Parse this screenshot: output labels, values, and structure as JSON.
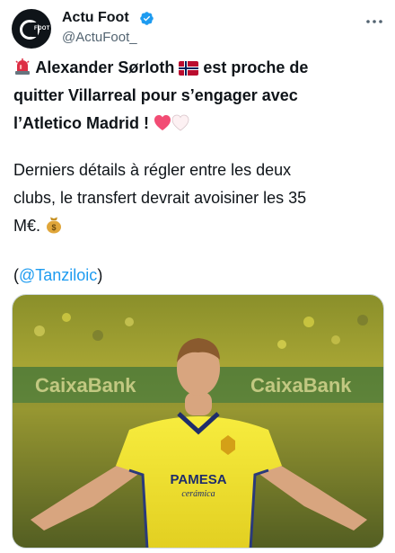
{
  "account": {
    "name": "Actu Foot",
    "handle": "@ActuFoot_",
    "avatar_text": "FOOT"
  },
  "tweet": {
    "headline": "Alexander Sørloth",
    "headline_cont1": " est proche de",
    "headline_cont2": "quitter Villarreal pour s’engager avec",
    "headline_cont3": "l’Atletico Madrid ! ",
    "body_line1": "Derniers détails à régler entre les deux",
    "body_line2": "clubs, le transfert devrait avoisiner les 35",
    "body_line3": "M€. ",
    "credit_open": "(",
    "credit_mention": "@Tanziloic",
    "credit_close": ")"
  },
  "media": {
    "sponsor": "PAMESA",
    "sponsor_sub": "cerámica"
  },
  "icons": [
    "siren-icon",
    "norway-flag-icon",
    "red-heart-icon",
    "white-heart-icon",
    "money-bag-icon",
    "verified-badge-icon",
    "more-icon"
  ],
  "colors": {
    "accent": "#1d9bf0",
    "text": "#0f1419",
    "secondary": "#536471",
    "jersey": "#f5e532"
  }
}
